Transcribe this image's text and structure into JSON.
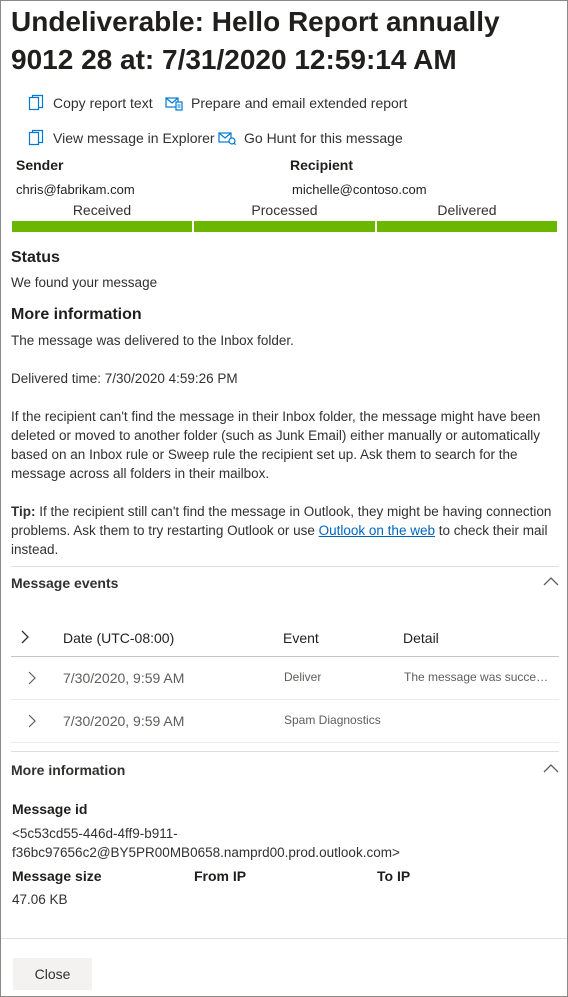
{
  "header": {
    "title": "Undeliverable: Hello Report annually 9012 28 at: 7/31/2020 12:59:14 AM"
  },
  "actions": {
    "copy_report": "Copy report text",
    "prepare_email": "Prepare and email extended report",
    "view_explorer": "View message in Explorer",
    "go_hunt": "Go Hunt for this message"
  },
  "parties": {
    "sender_label": "Sender",
    "sender_value": "chris@fabrikam.com",
    "recipient_label": "Recipient",
    "recipient_value": "michelle@contoso.com"
  },
  "progress": {
    "stages": [
      "Received",
      "Processed",
      "Delivered"
    ],
    "completed_fraction": 1.0,
    "color": "#6bb700"
  },
  "status": {
    "heading": "Status",
    "text": "We found your message"
  },
  "more_info_text": {
    "heading": "More information",
    "line1": "The message was delivered to the Inbox folder.",
    "delivered_time": "Delivered time: 7/30/2020 4:59:26 PM",
    "paragraph": "If the recipient can't find the message in their Inbox folder, the message might have been deleted or moved to another folder (such as Junk Email) either manually or automatically based on an Inbox rule or Sweep rule the recipient set up. Ask them to search for the message across all folders in their mailbox.",
    "tip_label": "Tip:",
    "tip_text": " If the recipient still can't find the message in Outlook, they might be having connection problems. Ask them to try restarting Outlook or use ",
    "tip_link": "Outlook on the web",
    "tip_end": " to check their mail instead."
  },
  "message_events": {
    "heading": "Message events",
    "columns": {
      "date": "Date (UTC-08:00)",
      "event": "Event",
      "detail": "Detail"
    },
    "rows": [
      {
        "date": "7/30/2020, 9:59 AM",
        "event": "Deliver",
        "detail": "The message was successfully delivered to the folder: Inbox"
      },
      {
        "date": "7/30/2020, 9:59 AM",
        "event": "Spam Diagnostics",
        "detail": ""
      }
    ]
  },
  "more_info_section": {
    "heading": "More information",
    "message_id_label": "Message id",
    "message_id_line1": "<5c53cd55-446d-4ff9-b911-",
    "message_id_line2": "f36bc97656c2@BY5PR00MB0658.namprd00.prod.outlook.com>",
    "size_label": "Message size",
    "size_value": "47.06 KB",
    "from_ip_label": "From IP",
    "to_ip_label": "To IP"
  },
  "footer": {
    "close_label": "Close"
  },
  "icons": {
    "copy": "copy-icon",
    "email": "email-report-icon",
    "explorer": "explorer-icon",
    "hunt": "hunt-icon",
    "caret_up": "chevron-up-icon",
    "chevron_right": "chevron-right-icon"
  },
  "colors": {
    "accent_icon": "#0078d4",
    "link": "#0064bf",
    "progress": "#6bb700"
  }
}
